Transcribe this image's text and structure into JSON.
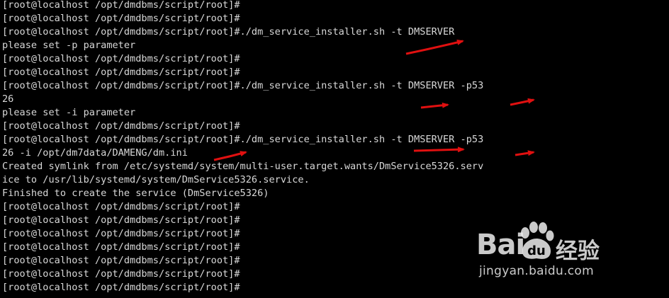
{
  "terminal": {
    "lines": [
      "[root@localhost /opt/dmdbms/script/root]#",
      "[root@localhost /opt/dmdbms/script/root]#",
      "[root@localhost /opt/dmdbms/script/root]#./dm_service_installer.sh -t DMSERVER",
      "please set -p parameter",
      "[root@localhost /opt/dmdbms/script/root]#",
      "[root@localhost /opt/dmdbms/script/root]#",
      "[root@localhost /opt/dmdbms/script/root]#./dm_service_installer.sh -t DMSERVER -p53",
      "26",
      "please set -i parameter",
      "[root@localhost /opt/dmdbms/script/root]#",
      "[root@localhost /opt/dmdbms/script/root]#./dm_service_installer.sh -t DMSERVER -p53",
      "26 -i /opt/dm7data/DAMENG/dm.ini",
      "Created symlink from /etc/systemd/system/multi-user.target.wants/DmService5326.serv",
      "ice to /usr/lib/systemd/system/DmService5326.service.",
      "Finished to create the service (DmService5326)",
      "[root@localhost /opt/dmdbms/script/root]#",
      "[root@localhost /opt/dmdbms/script/root]#",
      "[root@localhost /opt/dmdbms/script/root]#",
      "[root@localhost /opt/dmdbms/script/root]#",
      "[root@localhost /opt/dmdbms/script/root]#",
      "[root@localhost /opt/dmdbms/script/root]#",
      "[root@localhost /opt/dmdbms/script/root]#"
    ],
    "colors": {
      "background": "#000000",
      "text": "#d8d8d8",
      "annotation_arrow": "#e01010"
    }
  },
  "watermark": {
    "brand": "Bai",
    "brand_suffix": "",
    "chinese": "经验",
    "url": "jingyan.baidu.com",
    "icon": "paw-icon"
  }
}
